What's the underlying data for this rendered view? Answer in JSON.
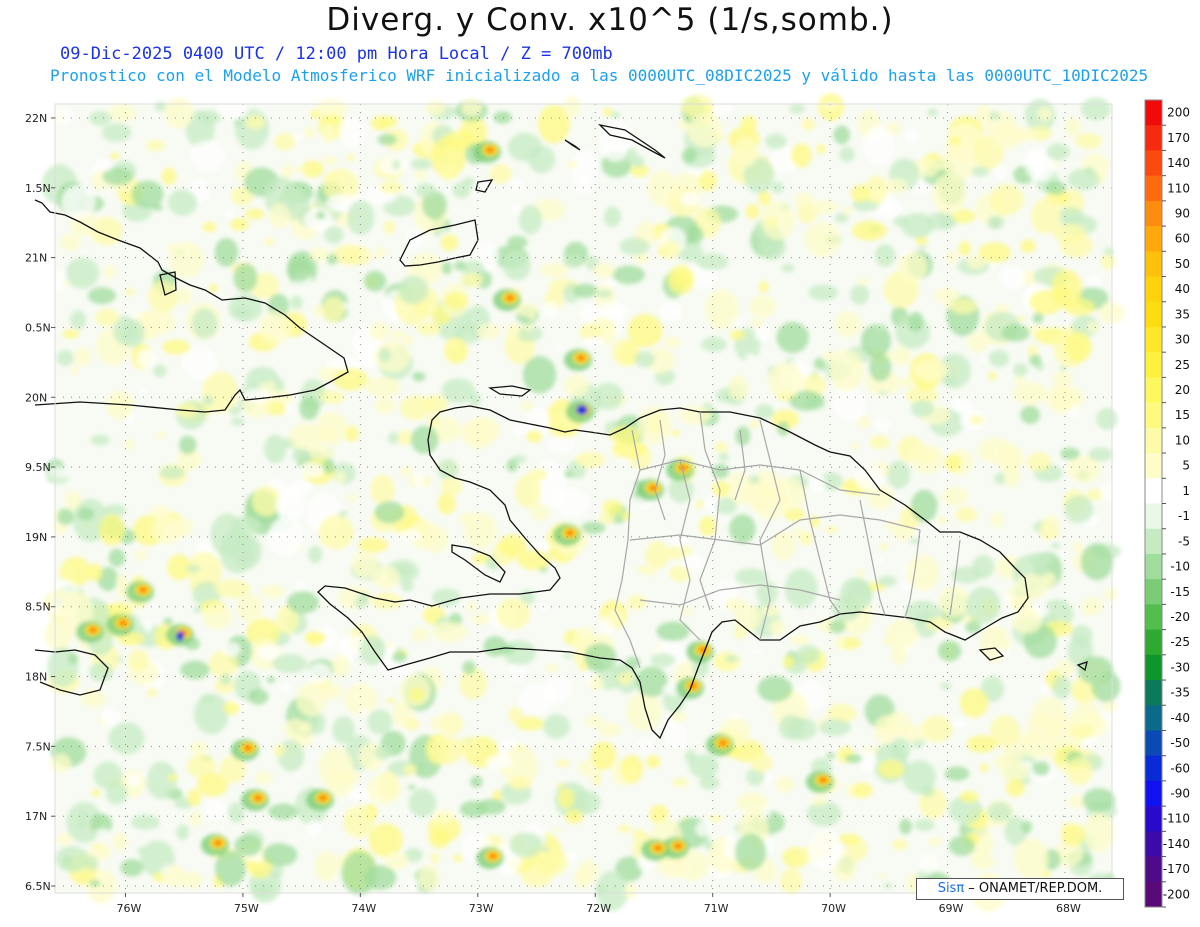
{
  "title": "Diverg. y Conv. x10^5 (1/s,somb.)",
  "subtitle_line1": "09-Dic-2025  0400 UTC / 12:00 pm Hora Local / Z = 700mb",
  "subtitle_line2": "Pronostico con el Modelo Atmosferico WRF inicializado a las 0000UTC_08DIC2025 y válido hasta las  0000UTC_10DIC2025",
  "map": {
    "lat_labels": [
      "22N",
      "1.5N",
      "21N",
      "0.5N",
      "20N",
      "9.5N",
      "19N",
      "8.5N",
      "18N",
      "7.5N",
      "17N",
      "6.5N"
    ],
    "lon_labels": [
      "76W",
      "75W",
      "74W",
      "73W",
      "72W",
      "71W",
      "70W",
      "69W",
      "68W"
    ],
    "lat_values": [
      22,
      21.5,
      21,
      20.5,
      20,
      19.5,
      19,
      18.5,
      18,
      17.5,
      17,
      16.5
    ],
    "lon_values": [
      -76,
      -75,
      -74,
      -73,
      -72,
      -71,
      -70,
      -69,
      -68
    ],
    "extent": {
      "lon_min": -76.6,
      "lon_max": -67.6,
      "lat_min": 16.45,
      "lat_max": 22.1
    },
    "field": "divergence/convergence x10^5 (1/s)",
    "regions": [
      "Cuba (east)",
      "Haiti",
      "Dominican Republic",
      "Turks and Caicos"
    ]
  },
  "colorbar": {
    "levels": [
      "200",
      "170",
      "140",
      "110",
      "90",
      "60",
      "50",
      "40",
      "35",
      "30",
      "25",
      "20",
      "15",
      "10",
      "5",
      "1",
      "-1",
      "-5",
      "-10",
      "-15",
      "-20",
      "-25",
      "-30",
      "-35",
      "-40",
      "-50",
      "-60",
      "-90",
      "-110",
      "-140",
      "-170",
      "-200"
    ],
    "colors": [
      "#f00a0a",
      "#f52a0e",
      "#fa4a0e",
      "#fe6a0e",
      "#fe8c0e",
      "#fea80c",
      "#fec00a",
      "#fed20c",
      "#fedd10",
      "#fee628",
      "#fef03c",
      "#fef860",
      "#fefa80",
      "#fefba8",
      "#fefcc8",
      "#ffffff",
      "#ebf7e9",
      "#c6ebc3",
      "#a0dc9c",
      "#7acd76",
      "#52be4e",
      "#2eaa30",
      "#0e962a",
      "#0a7a5a",
      "#0a6a8a",
      "#0a4ab4",
      "#0a2ad8",
      "#1010f0",
      "#2a0aca",
      "#3c0aa8",
      "#4e0a88",
      "#5a0a78"
    ]
  },
  "credit": {
    "sis": "Sisπ",
    "rest": " – ONAMET/REP.DOM."
  }
}
